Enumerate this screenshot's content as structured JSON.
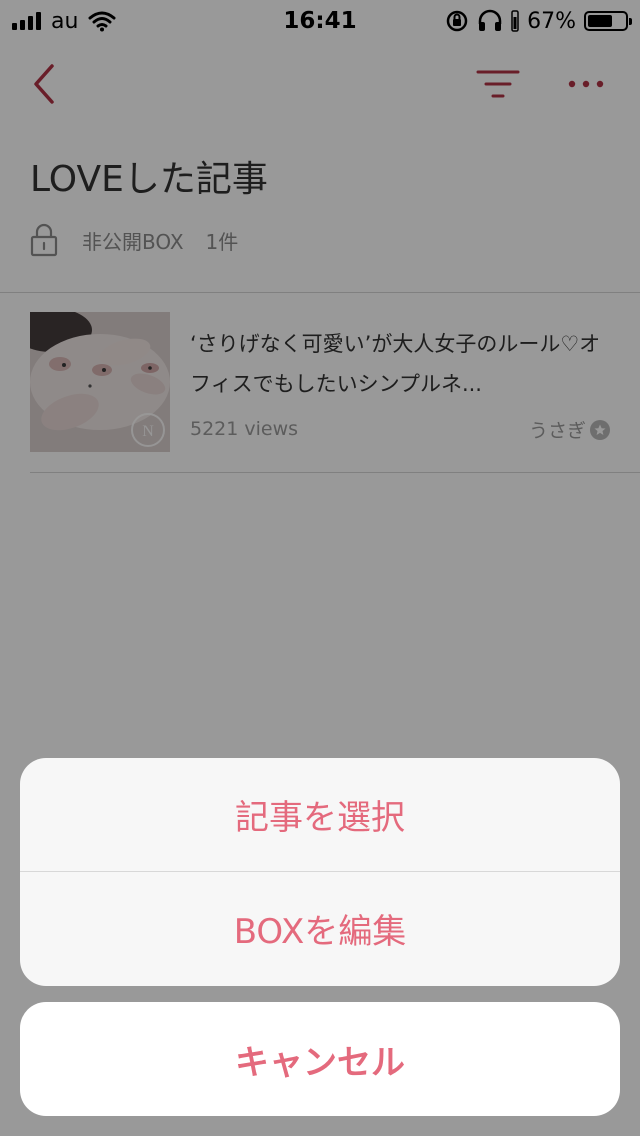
{
  "status_bar": {
    "carrier": "au",
    "time": "16:41",
    "battery_text": "67%",
    "battery_level": 0.67
  },
  "nav": {
    "back_icon": "chevron-left-icon",
    "filter_icon": "filter-icon",
    "more_icon": "more-icon"
  },
  "box": {
    "title": "LOVEした記事",
    "privacy_label": "非公開BOX",
    "count": "1件",
    "privacy_icon": "lock-icon"
  },
  "articles": [
    {
      "title": "‘さりげなく可愛い’が大人女子のルール♡オフィスでもしたいシンプルネ...",
      "views": "5221 views",
      "author": "うさぎ",
      "thumbnail": "nail-photo"
    }
  ],
  "action_sheet": {
    "select_articles": "記事を選択",
    "edit_box": "BOXを編集",
    "cancel": "キャンセル"
  },
  "colors": {
    "accent": "#e46a7d",
    "nav_icon": "#b03245",
    "overlay": "rgba(0,0,0,0.4)"
  }
}
